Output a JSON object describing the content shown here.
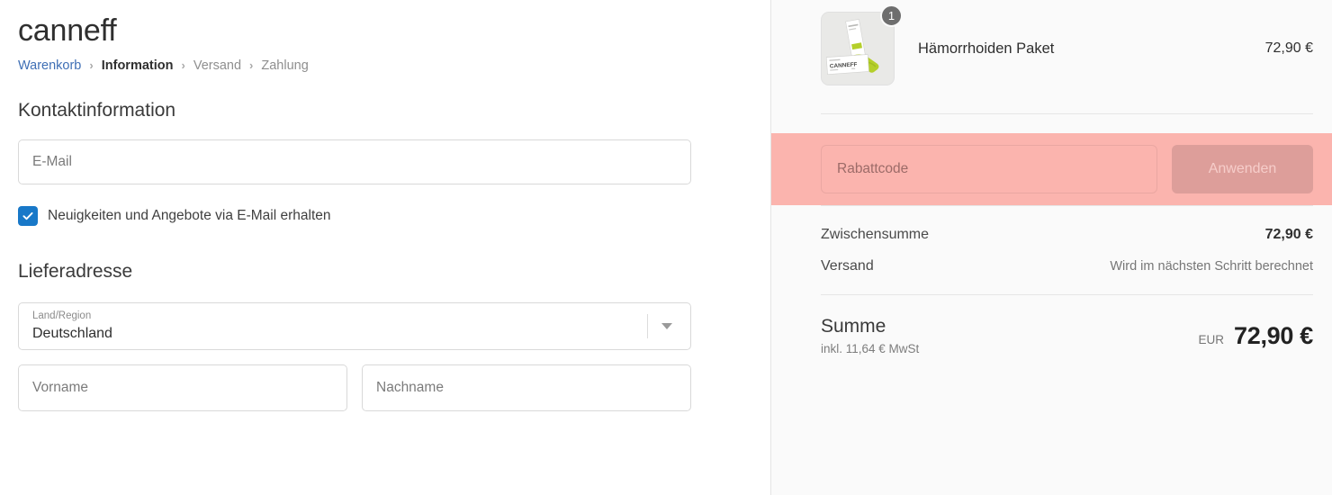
{
  "brand": "canneff",
  "breadcrumb": [
    {
      "label": "Warenkorb",
      "state": "link"
    },
    {
      "label": "Information",
      "state": "current"
    },
    {
      "label": "Versand",
      "state": "next"
    },
    {
      "label": "Zahlung",
      "state": "next"
    }
  ],
  "breadcrumb_separator": "›",
  "contact": {
    "title": "Kontaktinformation",
    "email_placeholder": "E-Mail",
    "email_value": "",
    "newsletter_label": "Neuigkeiten und Angebote via E-Mail erhalten",
    "newsletter_checked": true
  },
  "address": {
    "title": "Lieferadresse",
    "country_label": "Land/Region",
    "country_value": "Deutschland",
    "first_name_placeholder": "Vorname",
    "first_name_value": "",
    "last_name_placeholder": "Nachname",
    "last_name_value": ""
  },
  "summary": {
    "item": {
      "name": "Hämorrhoiden Paket",
      "price": "72,90 €",
      "quantity": "1"
    },
    "discount": {
      "placeholder": "Rabattcode",
      "value": "",
      "apply_label": "Anwenden",
      "highlighted": true
    },
    "subtotal_label": "Zwischensumme",
    "subtotal_value": "72,90 €",
    "shipping_label": "Versand",
    "shipping_value": "Wird im nächsten Schritt berechnet",
    "total_label": "Summe",
    "total_note": "inkl. 11,64 € MwSt",
    "total_currency": "EUR",
    "total_value": "72,90 €"
  },
  "colors": {
    "link": "#3f6fb5",
    "checkbox": "#1878c8",
    "highlight_band": "#fbb4ae",
    "apply_button": "#dd9e9a",
    "panel_bg": "#fafafa"
  }
}
